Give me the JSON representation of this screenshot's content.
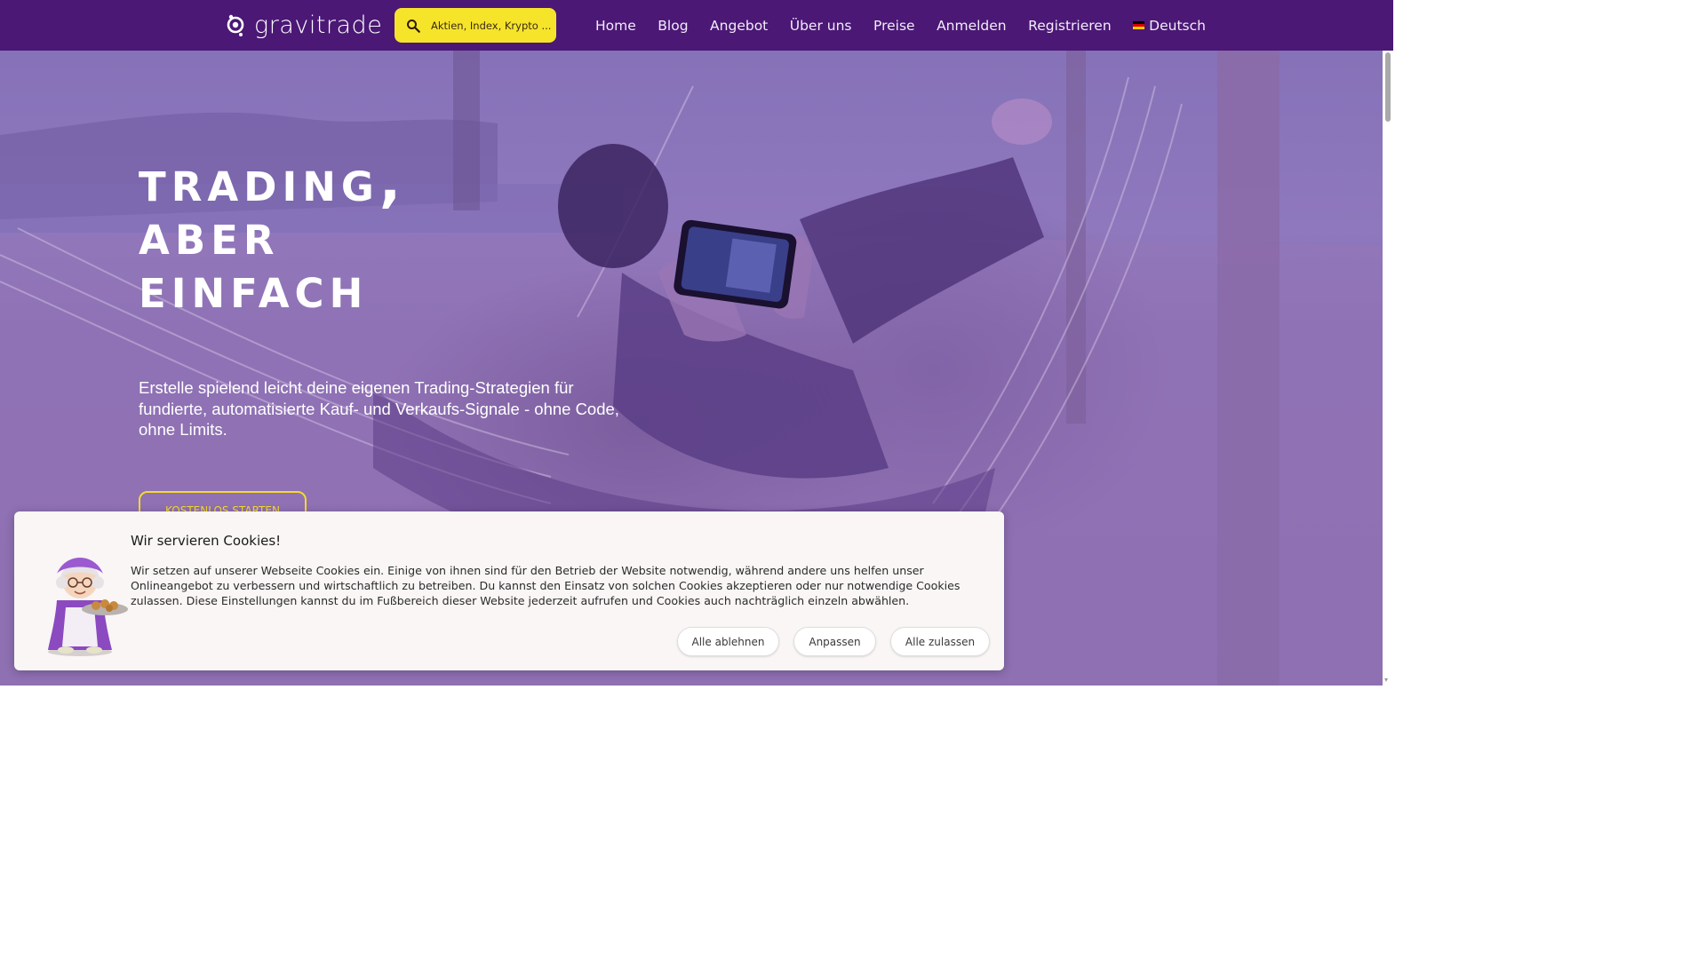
{
  "brand": {
    "name": "gravitrade",
    "icon": "gravitrade-logo-icon"
  },
  "search": {
    "placeholder": "Aktien, Index, Krypto ...",
    "icon": "search-icon"
  },
  "nav": {
    "items": [
      {
        "label": "Home"
      },
      {
        "label": "Blog"
      },
      {
        "label": "Angebot"
      },
      {
        "label": "Über uns"
      },
      {
        "label": "Preise"
      },
      {
        "label": "Anmelden"
      },
      {
        "label": "Registrieren"
      }
    ],
    "language": {
      "label": "Deutsch",
      "icon": "german-flag-icon"
    }
  },
  "hero": {
    "title_lines": [
      "Trading,",
      "aber",
      "einfach"
    ],
    "subtitle": "Erstelle spielend leicht deine eigenen Trading-Strategien für fundierte, automatisierte Kauf- und Verkaufs-Signale - ohne Code, ohne Limits.",
    "cta_label": "KOSTENLOS STARTEN"
  },
  "cookie_banner": {
    "title": "Wir servieren Cookies!",
    "text": "Wir setzen auf unserer Webseite Cookies ein. Einige von ihnen sind für den Betrieb der Website notwendig, während andere uns helfen unser Onlineangebot zu verbessern und wirtschaftlich zu betreiben. Du kannst den Einsatz von solchen Cookies akzeptieren oder nur notwendige Cookies zulassen. Diese Einstellungen kannst du im Fußbereich dieser Website jederzeit aufrufen und Cookies auch nachträglich einzeln abwählen.",
    "buttons": {
      "reject": "Alle ablehnen",
      "customize": "Anpassen",
      "accept": "Alle zulassen"
    }
  },
  "colors": {
    "navbar": "#4b1876",
    "search_bg": "#f6e42b",
    "cta_accent": "#f5d930",
    "hero_overlay": "#8a6db2"
  }
}
